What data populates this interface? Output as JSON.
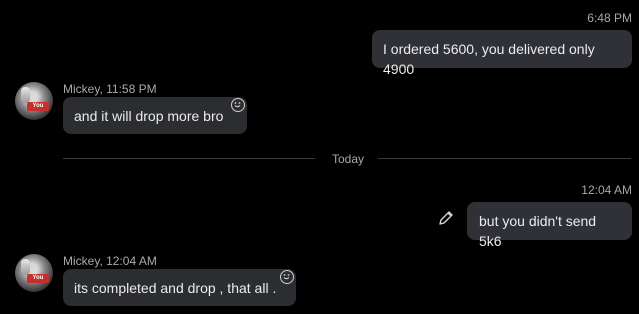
{
  "messages": [
    {
      "time": "6:48 PM",
      "text": "I ordered 5600, you delivered only 4900"
    },
    {
      "sender": "Mickey, 11:58 PM",
      "text": "and it will drop more bro"
    },
    {
      "time": "12:04 AM",
      "text": "but you didn't send 5k6"
    },
    {
      "sender": "Mickey, 12:04 AM",
      "text": "its completed and drop , that all ."
    }
  ],
  "divider": {
    "label": "Today"
  },
  "icons": {
    "reaction": "smiley-icon",
    "edit": "pencil-icon",
    "avatar_badge": "You"
  },
  "colors": {
    "background": "#000000",
    "bubble": "#2b2d31",
    "meta_text": "#a8a8aa"
  }
}
